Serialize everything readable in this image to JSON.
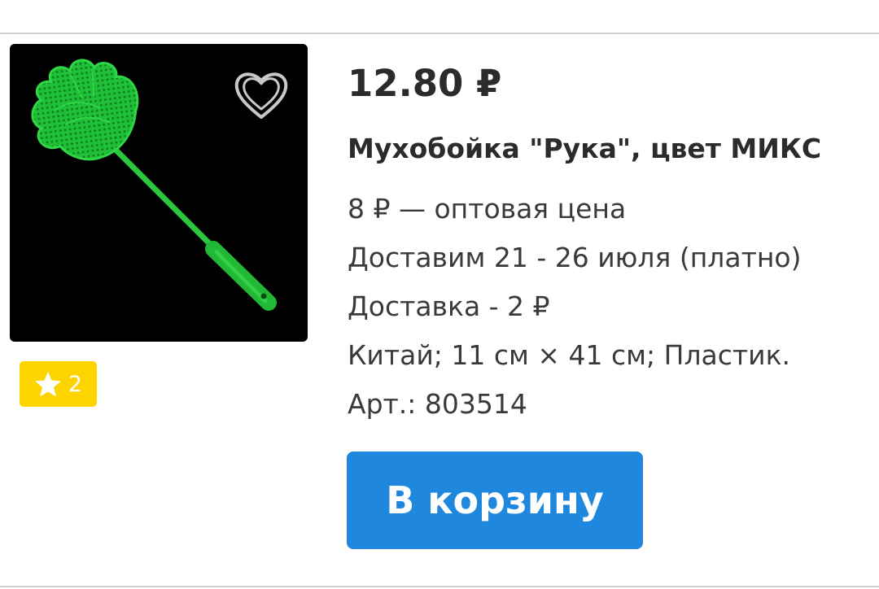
{
  "product": {
    "price": "12.80 ₽",
    "title": "Мухобойка \"Рука\", цвет МИКС",
    "wholesale_price": "8 ₽ — оптовая цена",
    "delivery_dates": "Доставим 21 - 26 июля (платно)",
    "delivery_cost": "Доставка - 2 ₽",
    "specs": "Китай; 11 см × 41 см; Пластик.",
    "article": "Арт.: 803514",
    "image_icon": "fly-swatter-hand-image"
  },
  "favorite": {
    "icon": "heart-outline-icon"
  },
  "rating": {
    "icon": "star-icon",
    "count": "2"
  },
  "actions": {
    "add_to_cart_label": "В корзину"
  },
  "colors": {
    "accent": "#1f87dd",
    "badge": "#fdd300",
    "swatter_green": "#22c83a"
  }
}
